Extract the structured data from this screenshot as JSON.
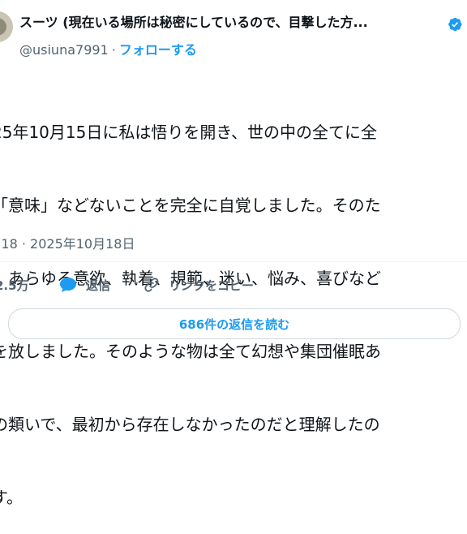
{
  "author": {
    "display_name": "スーツ (現在いる場所は秘密にしているので、目撃した方...",
    "handle": "@usiuna7991",
    "separator": "·",
    "follow_label": "フォローする"
  },
  "tweet": {
    "lines": [
      "25年10月15日に私は悟りを開き、世の中の全てに全",
      "「意味」などないことを完全に自覚しました。そのた",
      "、あらゆる意欲、執着、規範、迷い、悩み、喜びなど",
      "を放しました。そのような物は全て幻想や集団催眠あ",
      "の類いで、最初から存在しなかったのだと理解したの",
      "す。"
    ]
  },
  "meta": {
    "time": ":18",
    "separator": "·",
    "date": "2025年10月18日"
  },
  "actions": {
    "likes_count": "2.5万",
    "reply_label": "返信",
    "copy_link_label": "リンクをコピー"
  },
  "read_replies_label": "686件の返信を読む",
  "colors": {
    "accent": "#1d9bf0",
    "text": "#0f1419",
    "secondary": "#536471",
    "like_heart": "#f91880"
  },
  "icons": [
    "verified-badge-icon",
    "heart-icon",
    "reply-bubble-icon",
    "link-icon"
  ]
}
